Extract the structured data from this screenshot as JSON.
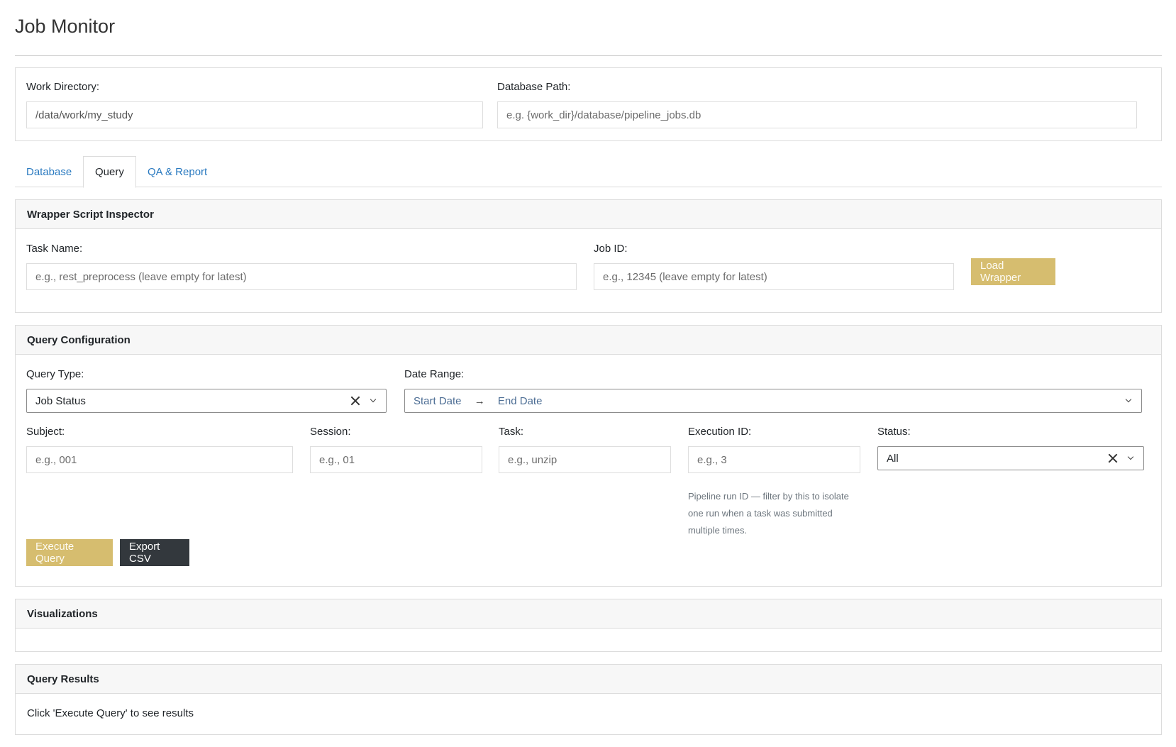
{
  "app": {
    "title": "Job Monitor"
  },
  "config": {
    "work_dir_label": "Work Directory:",
    "work_dir_value": "/data/work/my_study",
    "db_path_label": "Database Path:",
    "db_path_placeholder": "e.g. {work_dir}/database/pipeline_jobs.db"
  },
  "tabs": [
    {
      "label": "Database",
      "active": false
    },
    {
      "label": "Query",
      "active": true
    },
    {
      "label": "QA & Report",
      "active": false
    }
  ],
  "wrapper": {
    "title": "Wrapper Script Inspector",
    "task_label": "Task Name:",
    "task_placeholder": "e.g., rest_preprocess (leave empty for latest)",
    "job_label": "Job ID:",
    "job_placeholder": "e.g., 12345 (leave empty for latest)",
    "load_button": "Load Wrapper"
  },
  "query": {
    "title": "Query Configuration",
    "type_label": "Query Type:",
    "type_value": "Job Status",
    "date_label": "Date Range:",
    "date_start": "Start Date",
    "date_end": "End Date",
    "subject_label": "Subject:",
    "subject_placeholder": "e.g., 001",
    "session_label": "Session:",
    "session_placeholder": "e.g., 01",
    "task_label": "Task:",
    "task_placeholder": "e.g., unzip",
    "exec_label": "Execution ID:",
    "exec_placeholder": "e.g., 3",
    "exec_help": "Pipeline run ID — filter by this to isolate one run when a task was submitted multiple times.",
    "status_label": "Status:",
    "status_value": "All",
    "execute_button": "Execute Query",
    "export_button": "Export CSV"
  },
  "visualizations": {
    "title": "Visualizations"
  },
  "results": {
    "title": "Query Results",
    "empty_text": "Click 'Execute Query' to see results"
  },
  "colors": {
    "accent_gold": "#d6bd6f",
    "dark_button": "#33383d",
    "link_blue": "#2a7ac0"
  }
}
